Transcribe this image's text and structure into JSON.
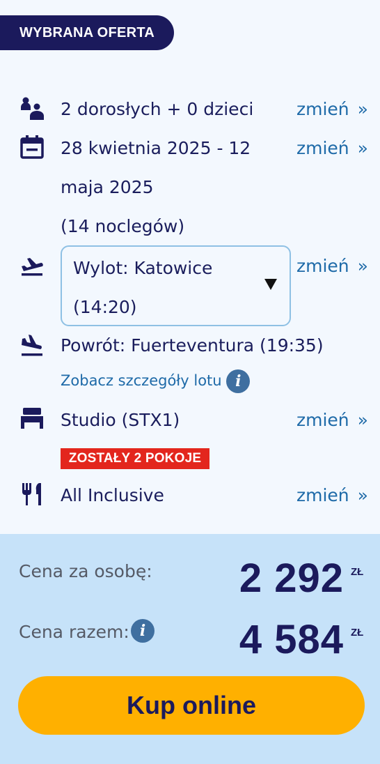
{
  "header": {
    "title": "WYBRANA OFERTA"
  },
  "change_label": "zmień",
  "change_arrow": "»",
  "rows": {
    "travelers": {
      "icon": "family-icon",
      "text": "2 dorosłych + 0 dzieci"
    },
    "dates": {
      "icon": "calendar-icon",
      "line1": "28 kwietnia 2025 - 12",
      "line2": "maja 2025",
      "line3": "(14 noclegów)"
    },
    "departure": {
      "icon": "plane-takeoff-icon",
      "line1": "Wylot: Katowice",
      "line2": "(14:20)"
    },
    "return": {
      "icon": "plane-landing-icon",
      "text": "Powrót: Fuerteventura (19:35)",
      "details_link": "Zobacz szczegóły lotu"
    },
    "room": {
      "icon": "bed-icon",
      "text": "Studio (STX1)",
      "availability_badge": "ZOSTAŁY 2 POKOJE"
    },
    "board": {
      "icon": "fork-knife-icon",
      "text": "All Inclusive"
    }
  },
  "price": {
    "per_person_label": "Cena za osobę:",
    "per_person_value": "2 292",
    "total_label": "Cena razem:",
    "total_value": "4 584",
    "currency": "ZŁ"
  },
  "info_glyph": "i",
  "buy_button": {
    "label": "Kup online"
  },
  "colors": {
    "navy": "#1b1a5c",
    "link": "#1e6aa8",
    "badge_red": "#e3261d",
    "panel_blue": "#c6e2f9",
    "button_yellow": "#ffb000"
  }
}
